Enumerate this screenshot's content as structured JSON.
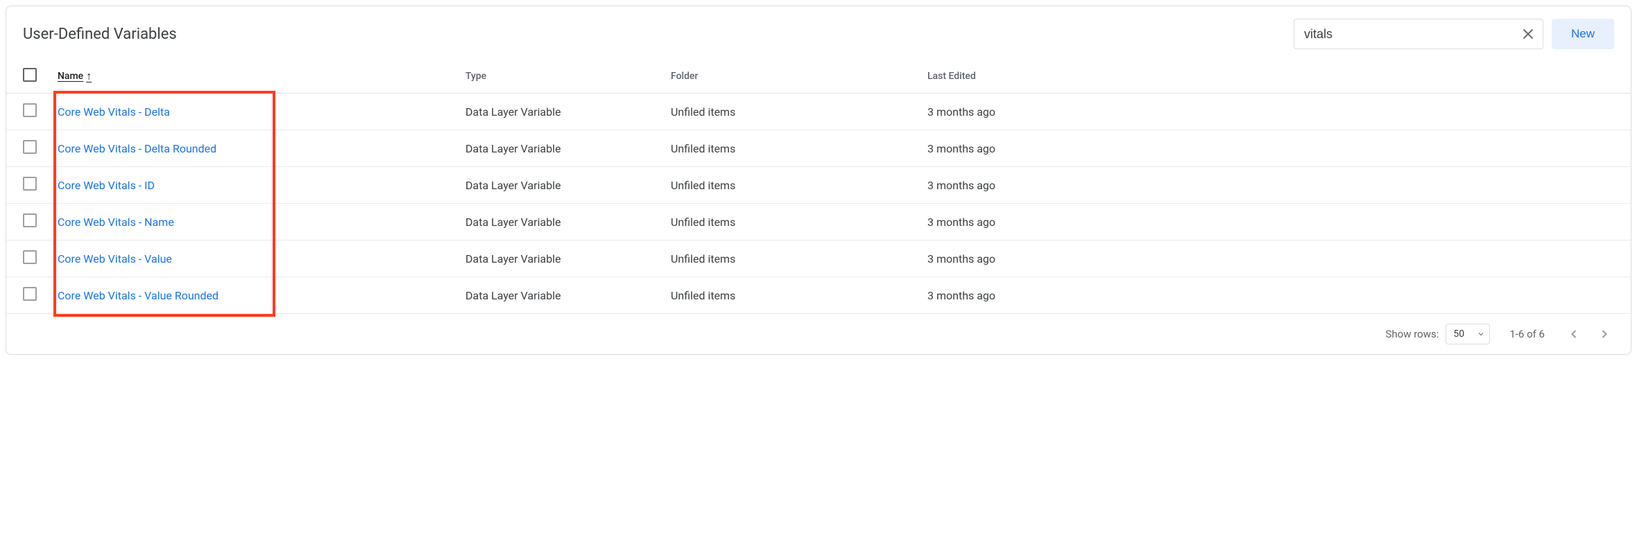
{
  "title": "User-Defined Variables",
  "search": {
    "value": "vitals"
  },
  "new_button": "New",
  "columns": {
    "name": "Name",
    "type": "Type",
    "folder": "Folder",
    "edited": "Last Edited"
  },
  "rows": [
    {
      "name": "Core Web Vitals - Delta",
      "type": "Data Layer Variable",
      "folder": "Unfiled items",
      "edited": "3 months ago"
    },
    {
      "name": "Core Web Vitals - Delta Rounded",
      "type": "Data Layer Variable",
      "folder": "Unfiled items",
      "edited": "3 months ago"
    },
    {
      "name": "Core Web Vitals - ID",
      "type": "Data Layer Variable",
      "folder": "Unfiled items",
      "edited": "3 months ago"
    },
    {
      "name": "Core Web Vitals - Name",
      "type": "Data Layer Variable",
      "folder": "Unfiled items",
      "edited": "3 months ago"
    },
    {
      "name": "Core Web Vitals - Value",
      "type": "Data Layer Variable",
      "folder": "Unfiled items",
      "edited": "3 months ago"
    },
    {
      "name": "Core Web Vitals - Value Rounded",
      "type": "Data Layer Variable",
      "folder": "Unfiled items",
      "edited": "3 months ago"
    }
  ],
  "footer": {
    "show_rows_label": "Show rows:",
    "rows_value": "50",
    "range": "1-6 of 6"
  }
}
